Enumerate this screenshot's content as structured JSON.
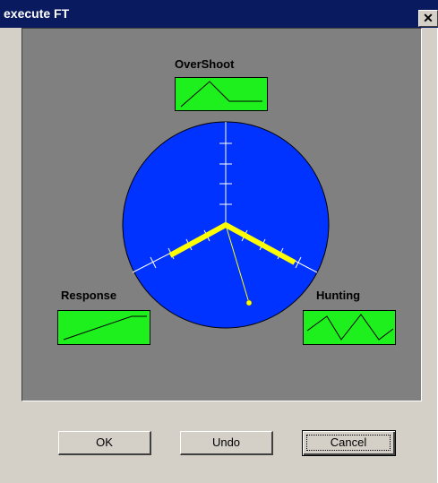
{
  "window": {
    "title": "execute FT",
    "close_glyph": "✕"
  },
  "labels": {
    "overshoot": "OverShoot",
    "response": "Response",
    "hunting": "Hunting"
  },
  "buttons": {
    "ok": "OK",
    "undo": "Undo",
    "cancel": "Cancel"
  },
  "icons": {
    "overshoot_thumb": "overshoot-curve-icon",
    "response_thumb": "response-curve-icon",
    "hunting_thumb": "hunting-curve-icon"
  },
  "colors": {
    "titlebar": "#0a1a5e",
    "panel": "#808080",
    "radar_fill": "#0033ff",
    "tuning_triangle": "#ffff00",
    "thumb_fill": "#1ef01e"
  }
}
